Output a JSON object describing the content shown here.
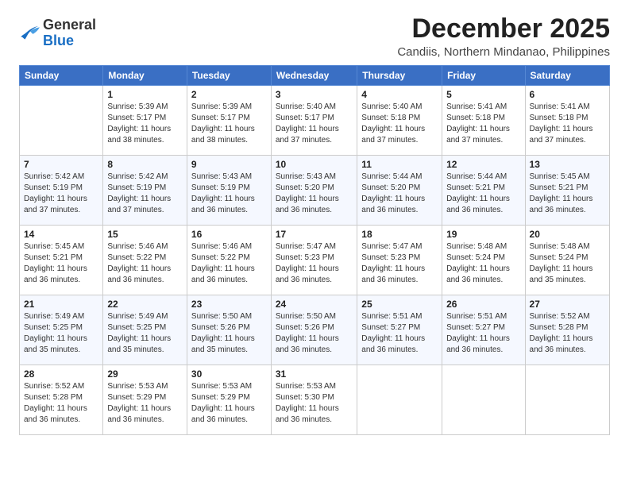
{
  "logo": {
    "general": "General",
    "blue": "Blue"
  },
  "header": {
    "month": "December 2025",
    "location": "Candiis, Northern Mindanao, Philippines"
  },
  "weekdays": [
    "Sunday",
    "Monday",
    "Tuesday",
    "Wednesday",
    "Thursday",
    "Friday",
    "Saturday"
  ],
  "weeks": [
    [
      {
        "day": "",
        "sunrise": "",
        "sunset": "",
        "daylight": ""
      },
      {
        "day": "1",
        "sunrise": "Sunrise: 5:39 AM",
        "sunset": "Sunset: 5:17 PM",
        "daylight": "Daylight: 11 hours and 38 minutes."
      },
      {
        "day": "2",
        "sunrise": "Sunrise: 5:39 AM",
        "sunset": "Sunset: 5:17 PM",
        "daylight": "Daylight: 11 hours and 38 minutes."
      },
      {
        "day": "3",
        "sunrise": "Sunrise: 5:40 AM",
        "sunset": "Sunset: 5:17 PM",
        "daylight": "Daylight: 11 hours and 37 minutes."
      },
      {
        "day": "4",
        "sunrise": "Sunrise: 5:40 AM",
        "sunset": "Sunset: 5:18 PM",
        "daylight": "Daylight: 11 hours and 37 minutes."
      },
      {
        "day": "5",
        "sunrise": "Sunrise: 5:41 AM",
        "sunset": "Sunset: 5:18 PM",
        "daylight": "Daylight: 11 hours and 37 minutes."
      },
      {
        "day": "6",
        "sunrise": "Sunrise: 5:41 AM",
        "sunset": "Sunset: 5:18 PM",
        "daylight": "Daylight: 11 hours and 37 minutes."
      }
    ],
    [
      {
        "day": "7",
        "sunrise": "Sunrise: 5:42 AM",
        "sunset": "Sunset: 5:19 PM",
        "daylight": "Daylight: 11 hours and 37 minutes."
      },
      {
        "day": "8",
        "sunrise": "Sunrise: 5:42 AM",
        "sunset": "Sunset: 5:19 PM",
        "daylight": "Daylight: 11 hours and 37 minutes."
      },
      {
        "day": "9",
        "sunrise": "Sunrise: 5:43 AM",
        "sunset": "Sunset: 5:19 PM",
        "daylight": "Daylight: 11 hours and 36 minutes."
      },
      {
        "day": "10",
        "sunrise": "Sunrise: 5:43 AM",
        "sunset": "Sunset: 5:20 PM",
        "daylight": "Daylight: 11 hours and 36 minutes."
      },
      {
        "day": "11",
        "sunrise": "Sunrise: 5:44 AM",
        "sunset": "Sunset: 5:20 PM",
        "daylight": "Daylight: 11 hours and 36 minutes."
      },
      {
        "day": "12",
        "sunrise": "Sunrise: 5:44 AM",
        "sunset": "Sunset: 5:21 PM",
        "daylight": "Daylight: 11 hours and 36 minutes."
      },
      {
        "day": "13",
        "sunrise": "Sunrise: 5:45 AM",
        "sunset": "Sunset: 5:21 PM",
        "daylight": "Daylight: 11 hours and 36 minutes."
      }
    ],
    [
      {
        "day": "14",
        "sunrise": "Sunrise: 5:45 AM",
        "sunset": "Sunset: 5:21 PM",
        "daylight": "Daylight: 11 hours and 36 minutes."
      },
      {
        "day": "15",
        "sunrise": "Sunrise: 5:46 AM",
        "sunset": "Sunset: 5:22 PM",
        "daylight": "Daylight: 11 hours and 36 minutes."
      },
      {
        "day": "16",
        "sunrise": "Sunrise: 5:46 AM",
        "sunset": "Sunset: 5:22 PM",
        "daylight": "Daylight: 11 hours and 36 minutes."
      },
      {
        "day": "17",
        "sunrise": "Sunrise: 5:47 AM",
        "sunset": "Sunset: 5:23 PM",
        "daylight": "Daylight: 11 hours and 36 minutes."
      },
      {
        "day": "18",
        "sunrise": "Sunrise: 5:47 AM",
        "sunset": "Sunset: 5:23 PM",
        "daylight": "Daylight: 11 hours and 36 minutes."
      },
      {
        "day": "19",
        "sunrise": "Sunrise: 5:48 AM",
        "sunset": "Sunset: 5:24 PM",
        "daylight": "Daylight: 11 hours and 36 minutes."
      },
      {
        "day": "20",
        "sunrise": "Sunrise: 5:48 AM",
        "sunset": "Sunset: 5:24 PM",
        "daylight": "Daylight: 11 hours and 35 minutes."
      }
    ],
    [
      {
        "day": "21",
        "sunrise": "Sunrise: 5:49 AM",
        "sunset": "Sunset: 5:25 PM",
        "daylight": "Daylight: 11 hours and 35 minutes."
      },
      {
        "day": "22",
        "sunrise": "Sunrise: 5:49 AM",
        "sunset": "Sunset: 5:25 PM",
        "daylight": "Daylight: 11 hours and 35 minutes."
      },
      {
        "day": "23",
        "sunrise": "Sunrise: 5:50 AM",
        "sunset": "Sunset: 5:26 PM",
        "daylight": "Daylight: 11 hours and 35 minutes."
      },
      {
        "day": "24",
        "sunrise": "Sunrise: 5:50 AM",
        "sunset": "Sunset: 5:26 PM",
        "daylight": "Daylight: 11 hours and 36 minutes."
      },
      {
        "day": "25",
        "sunrise": "Sunrise: 5:51 AM",
        "sunset": "Sunset: 5:27 PM",
        "daylight": "Daylight: 11 hours and 36 minutes."
      },
      {
        "day": "26",
        "sunrise": "Sunrise: 5:51 AM",
        "sunset": "Sunset: 5:27 PM",
        "daylight": "Daylight: 11 hours and 36 minutes."
      },
      {
        "day": "27",
        "sunrise": "Sunrise: 5:52 AM",
        "sunset": "Sunset: 5:28 PM",
        "daylight": "Daylight: 11 hours and 36 minutes."
      }
    ],
    [
      {
        "day": "28",
        "sunrise": "Sunrise: 5:52 AM",
        "sunset": "Sunset: 5:28 PM",
        "daylight": "Daylight: 11 hours and 36 minutes."
      },
      {
        "day": "29",
        "sunrise": "Sunrise: 5:53 AM",
        "sunset": "Sunset: 5:29 PM",
        "daylight": "Daylight: 11 hours and 36 minutes."
      },
      {
        "day": "30",
        "sunrise": "Sunrise: 5:53 AM",
        "sunset": "Sunset: 5:29 PM",
        "daylight": "Daylight: 11 hours and 36 minutes."
      },
      {
        "day": "31",
        "sunrise": "Sunrise: 5:53 AM",
        "sunset": "Sunset: 5:30 PM",
        "daylight": "Daylight: 11 hours and 36 minutes."
      },
      {
        "day": "",
        "sunrise": "",
        "sunset": "",
        "daylight": ""
      },
      {
        "day": "",
        "sunrise": "",
        "sunset": "",
        "daylight": ""
      },
      {
        "day": "",
        "sunrise": "",
        "sunset": "",
        "daylight": ""
      }
    ]
  ]
}
